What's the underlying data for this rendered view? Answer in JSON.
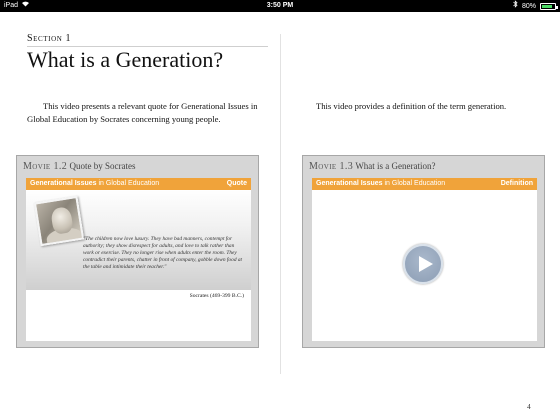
{
  "status_bar": {
    "device": "iPad",
    "time": "3:50 PM",
    "battery": "80%",
    "battery_level": 0.8,
    "icons": [
      "wifi-icon",
      "bluetooth-icon",
      "battery-icon"
    ]
  },
  "section": {
    "label": "Section 1",
    "title": "What is a Generation?"
  },
  "left_page": {
    "paragraph": "This video presents a relevant quote for Generational Issues in Global Education by Socrates concerning young people."
  },
  "right_page": {
    "paragraph": "This video provides a definition of the term generation."
  },
  "movie_1": {
    "number": "Movie 1.2",
    "caption": "Quote by Socrates",
    "bar_title": "Generational Issues",
    "bar_subtitle": "in Global Education",
    "bar_tag": "Quote",
    "quote": "\"The children now love luxury. They have bad manners, contempt for authority; they show disrespect for adults, and love to talk rather than work or exercise. They no longer rise when adults enter the room. They contradict their parents, chatter in front of company, gobble down food at the table and intimidate their teacher.\"",
    "attribution": "Socrates (469-399 B.C.)"
  },
  "movie_2": {
    "number": "Movie 1.3",
    "caption": "What is a Generation?",
    "bar_title": "Generational Issues",
    "bar_subtitle": "in Global Education",
    "bar_tag": "Definition",
    "control_icon": "play-icon"
  },
  "page_number": "4",
  "colors": {
    "accent_bar": "#f0a33a",
    "widget_bg": "#d6d6d6",
    "play_button": "#8c9db4"
  }
}
